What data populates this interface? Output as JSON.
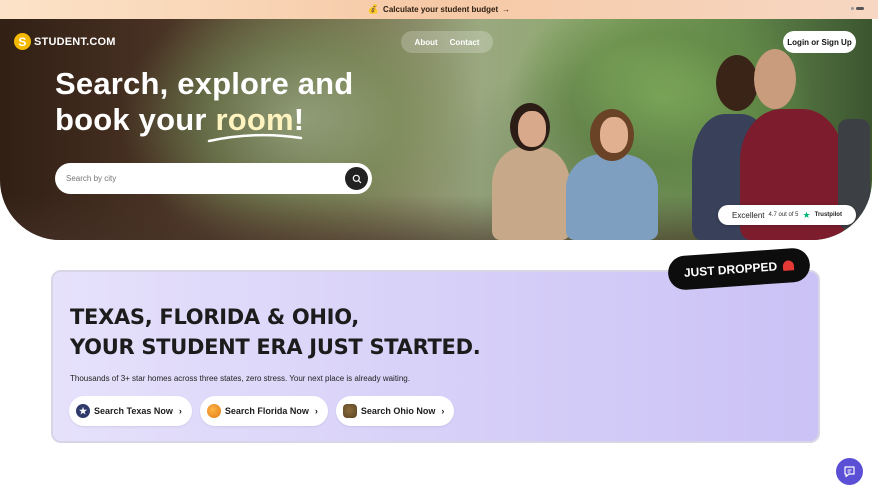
{
  "banner": {
    "text": "Calculate your student budget",
    "arrow": "→",
    "bag_icon": "money-bag-icon"
  },
  "header": {
    "logo_text": "STUDENT.COM",
    "logo_mark": "S",
    "nav": [
      {
        "label": "About"
      },
      {
        "label": "Contact"
      }
    ],
    "login_label": "Login or Sign Up"
  },
  "hero": {
    "title_line1": "Search, explore and",
    "title_line2_prefix": "book your ",
    "title_accent": "room",
    "title_suffix": "!",
    "search_placeholder": "Search by city"
  },
  "trustpilot": {
    "rating_word": "Excellent",
    "score": "4.7 out of 5",
    "star": "★",
    "brand": "Trustpilot"
  },
  "promo": {
    "badge": "JUST DROPPED",
    "title_line1": "TEXAS, FLORIDA & OHIO,",
    "title_line2": "YOUR STUDENT ERA JUST STARTED.",
    "subtitle": "Thousands of 3+ star homes across three states, zero stress. Your next place is already waiting.",
    "buttons": [
      {
        "label": "Search Texas Now",
        "icon": "texas-star-icon"
      },
      {
        "label": "Search Florida Now",
        "icon": "orange-icon"
      },
      {
        "label": "Search Ohio Now",
        "icon": "ohio-icon"
      }
    ]
  },
  "colors": {
    "accent": "#5b4fd6",
    "logo_yellow": "#f5b800",
    "promo_bg": "#d6cff8",
    "trust_green": "#00b67a"
  }
}
